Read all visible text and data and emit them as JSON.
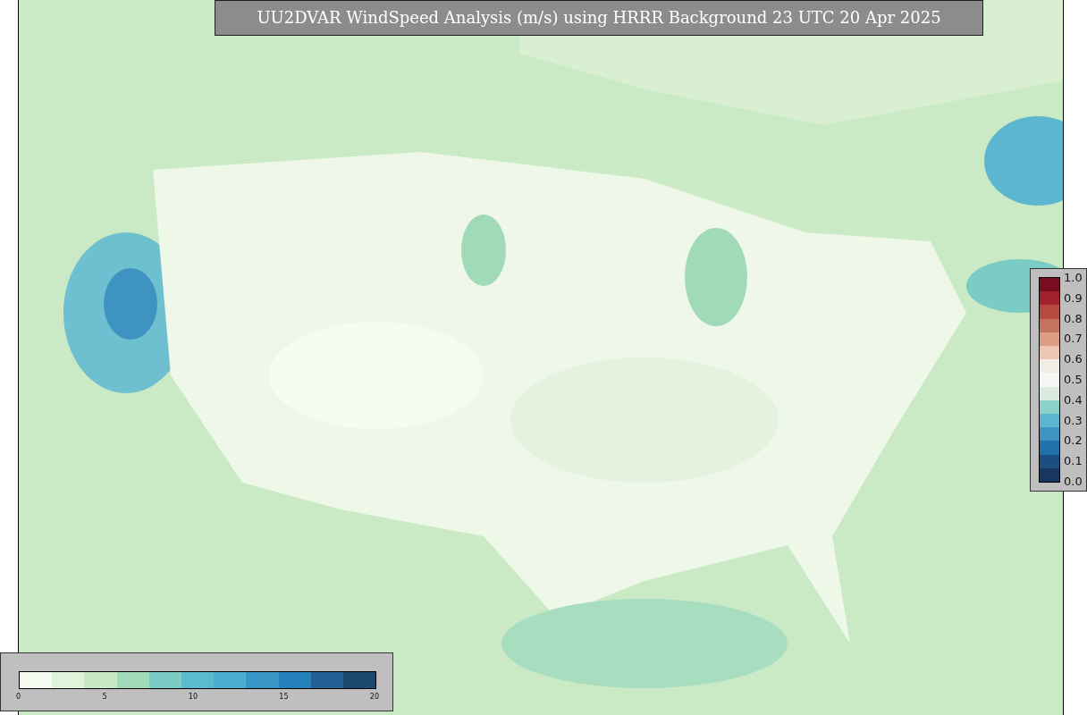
{
  "title": "UU2DVAR WindSpeed Analysis (m/s) using HRRR Background 23 UTC 20 Apr 2025",
  "ratio_colorbar": {
    "ticks": [
      "1.0",
      "0.9",
      "0.8",
      "0.7",
      "0.6",
      "0.5",
      "0.4",
      "0.3",
      "0.2",
      "0.1",
      "0.0"
    ],
    "segments": [
      {
        "color": "#7a0c20"
      },
      {
        "color": "#a2212e"
      },
      {
        "color": "#b54a3e"
      },
      {
        "color": "#c4735e"
      },
      {
        "color": "#dc9e82"
      },
      {
        "color": "#eec5b0"
      },
      {
        "color": "#f2ede6"
      },
      {
        "color": "#f6f6f4"
      },
      {
        "color": "#dcebe0"
      },
      {
        "color": "#8ad2c9"
      },
      {
        "color": "#5cb6d0"
      },
      {
        "color": "#3f93c1"
      },
      {
        "color": "#2170aa"
      },
      {
        "color": "#1b4f80"
      },
      {
        "color": "#17375f"
      }
    ]
  },
  "speed_colorbar": {
    "ticks": [
      "0",
      "5",
      "10",
      "15",
      "20"
    ],
    "segments": [
      {
        "color": "#f7fcf0"
      },
      {
        "color": "#e0f3db"
      },
      {
        "color": "#c6e9c4"
      },
      {
        "color": "#a0dab8"
      },
      {
        "color": "#7bccc4"
      },
      {
        "color": "#5bbad0"
      },
      {
        "color": "#4aaed0"
      },
      {
        "color": "#3896c6"
      },
      {
        "color": "#2481ba"
      },
      {
        "color": "#225f92"
      },
      {
        "color": "#1d4870"
      }
    ]
  }
}
